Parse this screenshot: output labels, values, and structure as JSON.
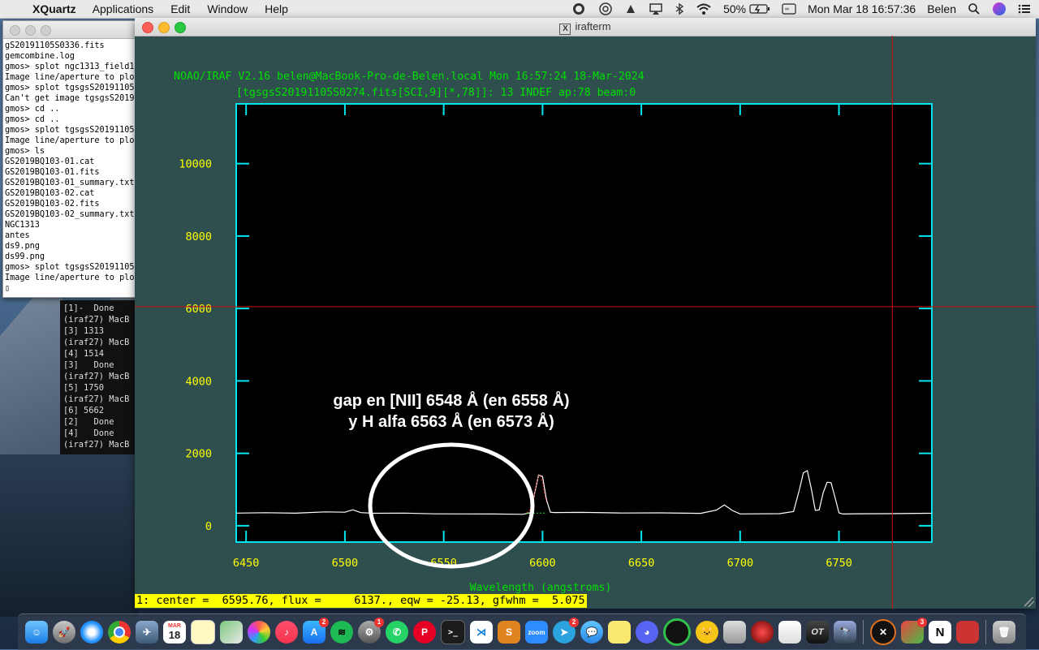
{
  "menubar": {
    "apple": "",
    "app_name": "XQuartz",
    "items": [
      "Applications",
      "Edit",
      "Window",
      "Help"
    ],
    "battery": "50%",
    "clock": "Mon Mar 18  16:57:36",
    "user": "Belen"
  },
  "xterm": {
    "lines": [
      "gS20191105S0336.fits",
      "gemcombine.log",
      "gmos> splot ngc1313_field1_",
      "Image line/aperture to plot",
      "gmos> splot tgsgsS20191105S",
      "Can't get image tgsgsS201911",
      "gmos> cd ..",
      "gmos> cd ..",
      "gmos> splot tgsgsS20191105S",
      "Image line/aperture to plot",
      "gmos> ls",
      "GS2019BQ103-01.cat",
      "GS2019BQ103-01.fits",
      "GS2019BQ103-01_summary.txt",
      "GS2019BQ103-02.cat",
      "GS2019BQ103-02.fits",
      "GS2019BQ103-02_summary.txt",
      "NGC1313",
      "antes",
      "ds9.png",
      "ds99.png",
      "gmos> splot tgsgsS20191105S",
      "Image line/aperture to plot",
      "▯"
    ]
  },
  "bgterm": {
    "lines": [
      "[1]-  Done",
      "(iraf27) MacB",
      "[3] 1313",
      "(iraf27) MacB",
      "[4] 1514",
      "[3]   Done",
      "(iraf27) MacB",
      "[5] 1750",
      "(iraf27) MacB",
      "[6] 5662",
      "[2]   Done",
      "[4]   Done",
      "(iraf27) MacB"
    ]
  },
  "irafterm": {
    "window_title": "irafterm",
    "header_line1": "NOAO/IRAF V2.16 belen@MacBook-Pro-de-Belen.local Mon 16:57:24 18-Mar-2024",
    "header_line2": "[tgsgsS20191105S0274.fits[SCI,9][*,78]]: 13 INDEF ap:78 beam:0",
    "annotation_line1": "gap en [NII] 6548 Å (en 6558 Å)",
    "annotation_line2": "y H alfa 6563 Å (en 6573 Å)",
    "status_line": "1: center =  6595.76, flux =     6137., eqw = -25.13, gfwhm =  5.075"
  },
  "chart_data": {
    "type": "line",
    "xlabel": "Wavelength (angstroms)",
    "ylabel": "",
    "title": "",
    "xlim": [
      6445,
      6797
    ],
    "ylim": [
      -450,
      11650
    ],
    "xticks": [
      6450,
      6500,
      6550,
      6600,
      6650,
      6700,
      6750
    ],
    "yticks": [
      0,
      2000,
      4000,
      6000,
      8000,
      10000
    ],
    "series": [
      {
        "x": [
          6445,
          6460,
          6475,
          6490,
          6500,
          6504,
          6508,
          6515,
          6530,
          6545,
          6560,
          6575,
          6590,
          6594,
          6596,
          6598,
          6600,
          6602,
          6604,
          6606,
          6620,
          6640,
          6660,
          6680,
          6688,
          6692,
          6696,
          6700,
          6720,
          6727,
          6730,
          6732,
          6734,
          6736,
          6738,
          6740,
          6742,
          6744,
          6746,
          6748,
          6750,
          6752,
          6760,
          6775,
          6797
        ],
        "y": [
          350,
          350,
          330,
          360,
          350,
          420,
          350,
          340,
          355,
          345,
          350,
          350,
          340,
          380,
          900,
          1400,
          1350,
          700,
          350,
          340,
          350,
          340,
          355,
          350,
          450,
          600,
          450,
          350,
          350,
          400,
          1000,
          1450,
          1500,
          1000,
          400,
          420,
          900,
          1200,
          1200,
          800,
          380,
          350,
          355,
          350,
          350
        ]
      }
    ],
    "cursor_crosshair": {
      "x": 6777,
      "y": 6050
    },
    "fit_marker_range": [
      6592,
      6602
    ]
  },
  "dock": {
    "calendar_month": "MAR",
    "calendar_day": "18",
    "telegram_badge": "2",
    "app_store_badge": "2",
    "settings_badge": "1",
    "right_badge": "3",
    "zoom_label": "zoom"
  },
  "colors": {
    "plot_frame": "#00e5ee",
    "yellow_text": "#ffff00",
    "green_text": "#00e000",
    "crosshair": "#cc1111",
    "window_bg": "#2f4f4f"
  }
}
